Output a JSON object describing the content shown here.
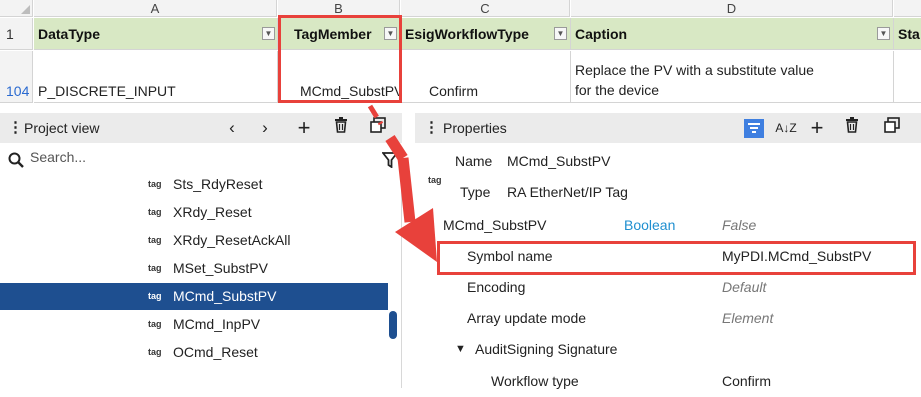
{
  "spreadsheet": {
    "column_letters": [
      "A",
      "B",
      "C",
      "D"
    ],
    "header_row_number": "1",
    "headers": [
      "DataType",
      "TagMember",
      "EsigWorkflowType",
      "Caption",
      "Sta"
    ],
    "data_row_number": "104",
    "data_row": {
      "datatype": "P_DISCRETE_INPUT",
      "tagmember": "MCmd_SubstPV",
      "workflow": "Confirm",
      "caption_line1": "Replace the PV with a substitute value",
      "caption_line2": "for the device"
    },
    "colors": {
      "header_fill": "#d8e8c4",
      "highlight": "#e8413b"
    }
  },
  "project_view": {
    "title": "Project view",
    "nav_back": "‹",
    "nav_forward": "›",
    "add_icon": "+",
    "search_placeholder": "Search...",
    "tag_label": "tag",
    "items": [
      "Sts_RdyReset",
      "XRdy_Reset",
      "XRdy_ResetAckAll",
      "MSet_SubstPV",
      "MCmd_SubstPV",
      "MCmd_InpPV",
      "OCmd_Reset"
    ],
    "selected_index": 4,
    "colors": {
      "selection": "#1e4f90"
    }
  },
  "properties": {
    "title": "Properties",
    "tag_label": "tag",
    "name_label": "Name",
    "name_value": "MCmd_SubstPV",
    "type_label": "Type",
    "type_value": "RA EtherNet/IP Tag",
    "tag_node": "MCmd_SubstPV",
    "tag_datatype": "Boolean",
    "tag_value": "False",
    "rows": [
      {
        "label": "Symbol name",
        "value": "MyPDI.MCmd_SubstPV"
      },
      {
        "label": "Encoding",
        "value": "Default"
      },
      {
        "label": "Array update mode",
        "value": "Element"
      }
    ],
    "section": "AuditSigning Signature",
    "section_rows": [
      {
        "label": "Workflow type",
        "value": "Confirm"
      }
    ],
    "az_icon": "A↓Z",
    "add_icon": "+",
    "colors": {
      "boolean": "#1f8fd0",
      "filter_active": "#3f7fe0"
    }
  }
}
